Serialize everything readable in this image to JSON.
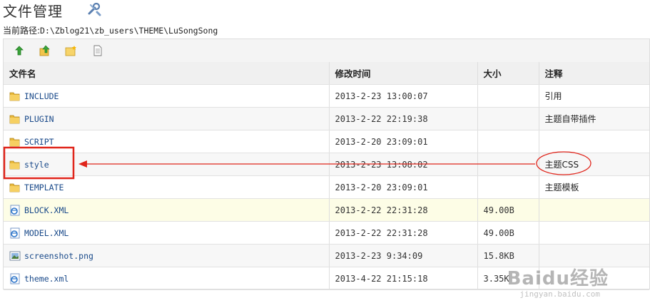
{
  "page": {
    "title": "文件管理",
    "path_label": "当前路径:",
    "path_value": "D:\\Zblog21\\zb_users\\THEME\\LuSongSong"
  },
  "toolbar": {
    "buttons": [
      {
        "name": "up-folder-icon"
      },
      {
        "name": "upload-icon"
      },
      {
        "name": "new-folder-icon"
      },
      {
        "name": "new-file-icon"
      }
    ]
  },
  "table": {
    "headers": {
      "name": "文件名",
      "time": "修改时间",
      "size": "大小",
      "note": "注释"
    },
    "rows": [
      {
        "name": "INCLUDE",
        "time": "2013-2-23 13:00:07",
        "size": "",
        "note": "引用",
        "icon": "folder-icon"
      },
      {
        "name": "PLUGIN",
        "time": "2013-2-22 22:19:38",
        "size": "",
        "note": "主题自带插件",
        "icon": "folder-icon"
      },
      {
        "name": "SCRIPT",
        "time": "2013-2-20 23:09:01",
        "size": "",
        "note": "",
        "icon": "folder-icon"
      },
      {
        "name": "style",
        "time": "2013-2-23 13:08:02",
        "size": "",
        "note": "主题CSS",
        "icon": "folder-icon"
      },
      {
        "name": "TEMPLATE",
        "time": "2013-2-20 23:09:01",
        "size": "",
        "note": "主题模板",
        "icon": "folder-icon"
      },
      {
        "name": "BLOCK.XML",
        "time": "2013-2-22 22:31:28",
        "size": "49.00B",
        "note": "",
        "icon": "xml-file-icon"
      },
      {
        "name": "MODEL.XML",
        "time": "2013-2-22 22:31:28",
        "size": "49.00B",
        "note": "",
        "icon": "xml-file-icon"
      },
      {
        "name": "screenshot.png",
        "time": "2013-2-23 9:34:09",
        "size": "15.8KB",
        "note": "",
        "icon": "image-file-icon"
      },
      {
        "name": "theme.xml",
        "time": "2013-4-22 21:15:18",
        "size": "3.35K",
        "note": "",
        "icon": "xml-file-icon"
      }
    ]
  },
  "annotation": {
    "color": "#e0251b"
  },
  "watermark": {
    "text": "Baidu经验",
    "sub": "jingyan.baidu.com"
  }
}
